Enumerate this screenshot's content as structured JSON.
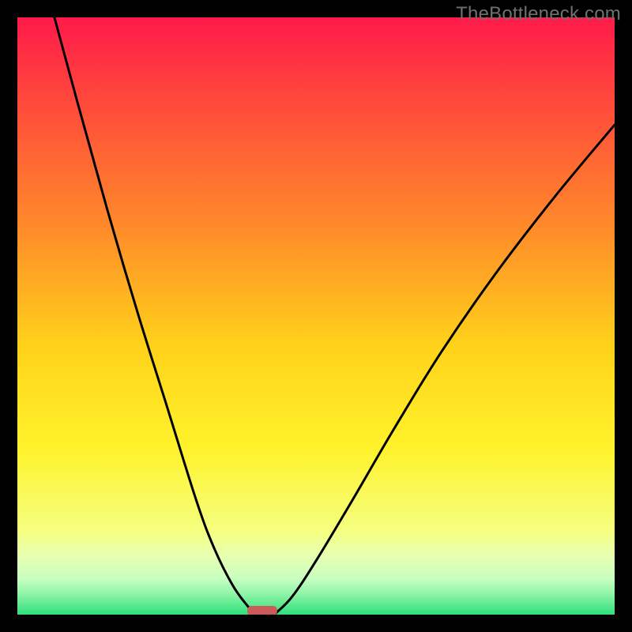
{
  "watermark": "TheBottleneck.com",
  "chart_data": {
    "type": "line",
    "title": "",
    "xlabel": "",
    "ylabel": "",
    "xlim": [
      0,
      1
    ],
    "ylim": [
      0,
      1
    ],
    "description": "Bottleneck-style chart with rainbow gradient background (red top to green bottom), two black curves descending to the x-axis at an optimum near x≈0.40, and a small red marker segment on the x-axis at the optimum.",
    "gradient_stops": [
      {
        "offset": 0.0,
        "color": "#ff1a4a"
      },
      {
        "offset": 0.15,
        "color": "#ff4c3a"
      },
      {
        "offset": 0.35,
        "color": "#ff8a2a"
      },
      {
        "offset": 0.55,
        "color": "#ffd21a"
      },
      {
        "offset": 0.72,
        "color": "#fff22a"
      },
      {
        "offset": 0.86,
        "color": "#f5ff80"
      },
      {
        "offset": 0.9,
        "color": "#e8ffb0"
      },
      {
        "offset": 0.94,
        "color": "#c8ffc0"
      },
      {
        "offset": 0.965,
        "color": "#90f5a8"
      },
      {
        "offset": 1.0,
        "color": "#2ee07a"
      }
    ],
    "series": [
      {
        "name": "left-curve",
        "x": [
          0.062,
          0.1,
          0.15,
          0.2,
          0.25,
          0.3,
          0.33,
          0.36,
          0.385,
          0.4
        ],
        "y": [
          1.0,
          0.86,
          0.68,
          0.51,
          0.35,
          0.19,
          0.11,
          0.05,
          0.015,
          0.0
        ]
      },
      {
        "name": "right-curve",
        "x": [
          0.43,
          0.46,
          0.5,
          0.56,
          0.63,
          0.71,
          0.8,
          0.9,
          1.0
        ],
        "y": [
          0.0,
          0.03,
          0.09,
          0.19,
          0.31,
          0.44,
          0.57,
          0.7,
          0.82
        ]
      }
    ],
    "optimum_marker": {
      "x_start": 0.385,
      "x_end": 0.435,
      "y": 0.0,
      "color": "#cc5a5a"
    }
  }
}
